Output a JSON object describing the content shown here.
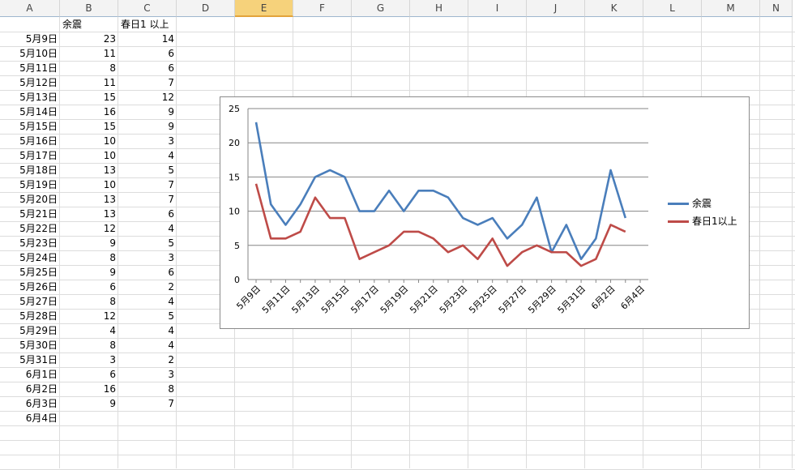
{
  "sheet": {
    "columns": [
      "A",
      "B",
      "C",
      "D",
      "E",
      "F",
      "G",
      "H",
      "I",
      "J",
      "K",
      "L",
      "M",
      "N"
    ],
    "selected_column": "E",
    "header_row": {
      "B": "余震",
      "C": "春日1 以上"
    },
    "rows": [
      {
        "date": "5月9日",
        "b": "23",
        "c": "14"
      },
      {
        "date": "5月10日",
        "b": "11",
        "c": "6"
      },
      {
        "date": "5月11日",
        "b": "8",
        "c": "6"
      },
      {
        "date": "5月12日",
        "b": "11",
        "c": "7"
      },
      {
        "date": "5月13日",
        "b": "15",
        "c": "12"
      },
      {
        "date": "5月14日",
        "b": "16",
        "c": "9"
      },
      {
        "date": "5月15日",
        "b": "15",
        "c": "9"
      },
      {
        "date": "5月16日",
        "b": "10",
        "c": "3"
      },
      {
        "date": "5月17日",
        "b": "10",
        "c": "4"
      },
      {
        "date": "5月18日",
        "b": "13",
        "c": "5"
      },
      {
        "date": "5月19日",
        "b": "10",
        "c": "7"
      },
      {
        "date": "5月20日",
        "b": "13",
        "c": "7"
      },
      {
        "date": "5月21日",
        "b": "13",
        "c": "6"
      },
      {
        "date": "5月22日",
        "b": "12",
        "c": "4"
      },
      {
        "date": "5月23日",
        "b": "9",
        "c": "5"
      },
      {
        "date": "5月24日",
        "b": "8",
        "c": "3"
      },
      {
        "date": "5月25日",
        "b": "9",
        "c": "6"
      },
      {
        "date": "5月26日",
        "b": "6",
        "c": "2"
      },
      {
        "date": "5月27日",
        "b": "8",
        "c": "4"
      },
      {
        "date": "5月28日",
        "b": "12",
        "c": "5"
      },
      {
        "date": "5月29日",
        "b": "4",
        "c": "4"
      },
      {
        "date": "5月30日",
        "b": "8",
        "c": "4"
      },
      {
        "date": "5月31日",
        "b": "3",
        "c": "2"
      },
      {
        "date": "6月1日",
        "b": "6",
        "c": "3"
      },
      {
        "date": "6月2日",
        "b": "16",
        "c": "8"
      },
      {
        "date": "6月3日",
        "b": "9",
        "c": "7"
      },
      {
        "date": "6月4日",
        "b": "",
        "c": ""
      }
    ]
  },
  "chart_data": {
    "type": "line",
    "ylim": [
      0,
      25
    ],
    "yticks": [
      "0",
      "5",
      "10",
      "15",
      "20",
      "25"
    ],
    "grid": true,
    "legend_position": "right",
    "x_tick_labels": [
      "5月9日",
      "5月11日",
      "5月13日",
      "5月15日",
      "5月17日",
      "5月19日",
      "5月21日",
      "5月23日",
      "5月25日",
      "5月27日",
      "5月29日",
      "5月31日",
      "6月2日",
      "6月4日"
    ],
    "categories": [
      "5月9日",
      "5月10日",
      "5月11日",
      "5月12日",
      "5月13日",
      "5月14日",
      "5月15日",
      "5月16日",
      "5月17日",
      "5月18日",
      "5月19日",
      "5月20日",
      "5月21日",
      "5月22日",
      "5月23日",
      "5月24日",
      "5月25日",
      "5月26日",
      "5月27日",
      "5月28日",
      "5月29日",
      "5月30日",
      "5月31日",
      "6月1日",
      "6月2日",
      "6月3日",
      "6月4日"
    ],
    "series": [
      {
        "name": "余震",
        "color": "#4a7ebb",
        "values": [
          23,
          11,
          8,
          11,
          15,
          16,
          15,
          10,
          10,
          13,
          10,
          13,
          13,
          12,
          9,
          8,
          9,
          6,
          8,
          12,
          4,
          8,
          3,
          6,
          16,
          9
        ]
      },
      {
        "name": "春日1以上",
        "color": "#be4b48",
        "values": [
          14,
          6,
          6,
          7,
          12,
          9,
          9,
          3,
          4,
          5,
          7,
          7,
          6,
          4,
          5,
          3,
          6,
          2,
          4,
          5,
          4,
          4,
          2,
          3,
          8,
          7
        ]
      }
    ]
  }
}
